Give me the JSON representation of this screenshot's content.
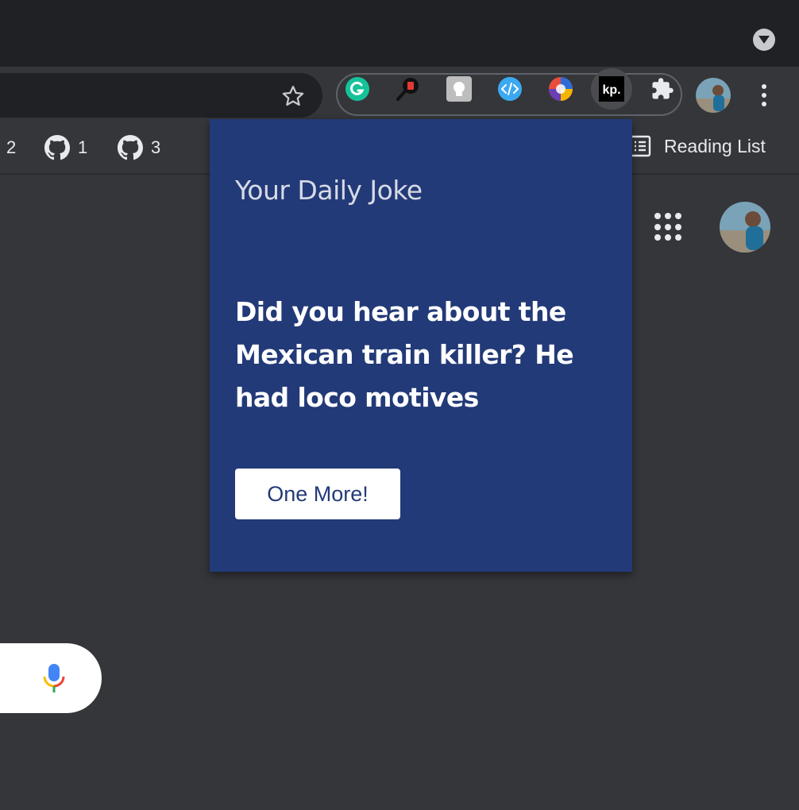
{
  "bookmarks": [
    {
      "label": "2",
      "icon": "github-icon"
    },
    {
      "label": "1",
      "icon": "github-icon"
    },
    {
      "label": "3",
      "icon": "github-icon"
    }
  ],
  "reading_list": {
    "label": "Reading List",
    "icon": "reading-list-icon"
  },
  "extensions": [
    {
      "name": "grammarly",
      "icon": "grammarly-icon",
      "color": "#15c39a"
    },
    {
      "name": "magnifier",
      "icon": "magnifier-icon",
      "color": "#e53935"
    },
    {
      "name": "lightbulb",
      "icon": "lightbulb-icon",
      "color": "#bdbdbd"
    },
    {
      "name": "code",
      "icon": "code-icon",
      "color": "#3ba9f2"
    },
    {
      "name": "colorful",
      "icon": "colorful-ball-icon",
      "color": "#e94e3c"
    },
    {
      "name": "kp",
      "icon": "kp-icon",
      "label": "kp.",
      "active": true
    },
    {
      "name": "extensions",
      "icon": "puzzle-icon"
    }
  ],
  "popup": {
    "title": "Your Daily Joke",
    "joke": "Did you hear about the Mexican train killer? He had loco motives",
    "button_label": "One More!",
    "background": "#233a78"
  },
  "colors": {
    "tabstrip": "#202124",
    "toolbar": "#35363a",
    "page": "#35363a"
  }
}
